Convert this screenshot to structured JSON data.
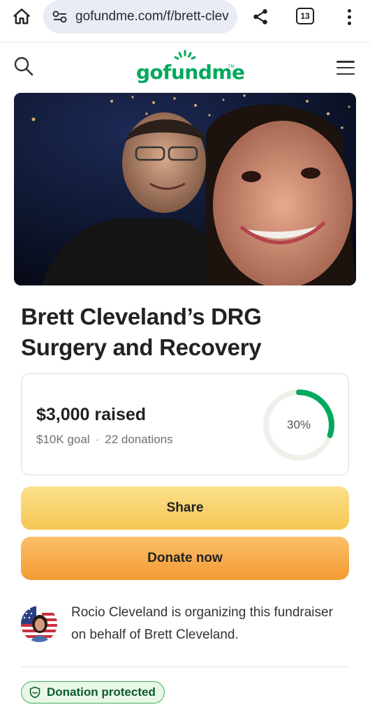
{
  "browser": {
    "url": "gofundme.com/f/brett-clev",
    "tab_count": "13"
  },
  "site": {
    "logo_text": "gofundme",
    "logo_tm": "TM"
  },
  "campaign": {
    "title": "Brett Cleveland’s DRG Surgery and Recovery",
    "raised": "$3,000 raised",
    "goal": "$10K goal",
    "separator": "·",
    "donations": "22 donations",
    "progress_label": "30%",
    "progress_fraction": 0.3
  },
  "buttons": {
    "share": "Share",
    "donate": "Donate now"
  },
  "organizer": {
    "text": "Rocio Cleveland is organizing this fundraiser on behalf of Brett Cleveland."
  },
  "badge": {
    "label": "Donation protected"
  },
  "colors": {
    "brand": "#02a95c",
    "progress": "#02a95c",
    "share_button": "#f6c752",
    "donate_button": "#f49a32"
  },
  "icons": [
    "home-icon",
    "site-settings-icon",
    "share-icon",
    "tabs-icon",
    "more-vert-icon",
    "search-icon",
    "hamburger-menu-icon",
    "shield-icon"
  ]
}
